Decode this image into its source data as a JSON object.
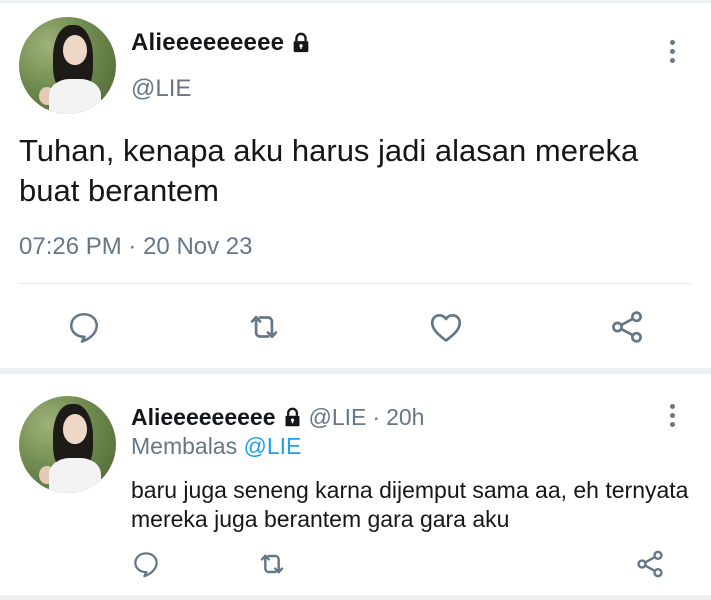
{
  "main_tweet": {
    "display_name": "Alieeeeeeeee",
    "handle": "@LIE",
    "text": "Tuhan, kenapa aku harus jadi alasan mereka buat berantem",
    "time": "07:26 PM",
    "separator": "·",
    "date": "20 Nov 23",
    "icons": [
      "lock-icon",
      "more-options-icon",
      "reply-icon",
      "retweet-icon",
      "like-icon",
      "share-icon"
    ]
  },
  "reply_tweet": {
    "display_name": "Alieeeeeeeee",
    "handle": "@LIE",
    "separator": "·",
    "time_ago": "20h",
    "replying_label": "Membalas",
    "replying_to": "@LIE",
    "text": "baru juga seneng karna dijemput sama aa, eh ternyata mereka juga berantem gara gara aku",
    "icons": [
      "lock-icon",
      "more-options-icon",
      "reply-icon",
      "retweet-icon",
      "share-icon"
    ]
  },
  "colors": {
    "text_primary": "#14171a",
    "text_secondary": "#657786",
    "accent": "#1da1f2",
    "divider": "#e1e8ed"
  }
}
